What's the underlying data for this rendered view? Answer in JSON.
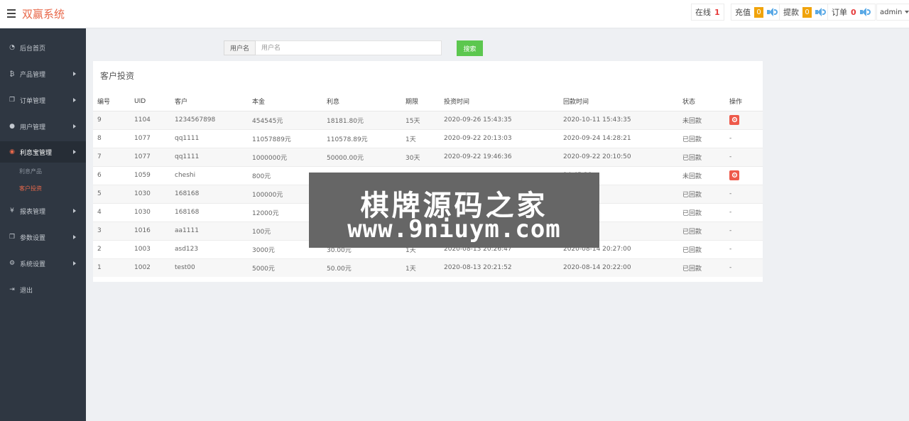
{
  "header": {
    "brand": "双赢系统",
    "online_label": "在线",
    "online_count": "1",
    "recharge_label": "充值",
    "recharge_count": "0",
    "withdraw_label": "提款",
    "withdraw_count": "0",
    "order_label": "订单",
    "order_count": "0",
    "user": "admin"
  },
  "sidebar": {
    "items": [
      {
        "label": "后台首页",
        "icon": "dashboard-icon"
      },
      {
        "label": "产品管理",
        "icon": "bitcoin-icon"
      },
      {
        "label": "订单管理",
        "icon": "copy-icon"
      },
      {
        "label": "用户管理",
        "icon": "user-icon"
      },
      {
        "label": "利息宝管理",
        "icon": "circle-icon"
      },
      {
        "label": "报表管理",
        "icon": "yen-icon"
      },
      {
        "label": "参数设置",
        "icon": "copy-icon"
      },
      {
        "label": "系统设置",
        "icon": "gears-icon"
      },
      {
        "label": "退出",
        "icon": "sign-out-icon"
      }
    ],
    "sub_items": [
      "利息产品",
      "客户投资"
    ]
  },
  "search": {
    "addon": "用户名",
    "placeholder": "用户名",
    "button": "搜索"
  },
  "panel": {
    "title": "客户投资",
    "columns": [
      "编号",
      "UID",
      "客户",
      "本金",
      "利息",
      "期限",
      "投资时间",
      "回款时间",
      "状态",
      "操作"
    ],
    "rows": [
      [
        "9",
        "1104",
        "1234567898",
        "454545元",
        "18181.80元",
        "15天",
        "2020-09-26 15:43:35",
        "2020-10-11 15:43:35",
        "未回款",
        ""
      ],
      [
        "8",
        "1077",
        "qq1111",
        "11057889元",
        "110578.89元",
        "1天",
        "2020-09-22 20:13:03",
        "2020-09-24 14:28:21",
        "已回款",
        "-"
      ],
      [
        "7",
        "1077",
        "qq1111",
        "1000000元",
        "50000.00元",
        "30天",
        "2020-09-22 19:46:36",
        "2020-09-22 20:10:50",
        "已回款",
        "-"
      ],
      [
        "6",
        "1059",
        "cheshi",
        "800元",
        "",
        "",
        "",
        "14:45:28",
        "未回款",
        ""
      ],
      [
        "5",
        "1030",
        "168168",
        "100000元",
        "",
        "",
        "",
        "12:09:00",
        "已回款",
        "-"
      ],
      [
        "4",
        "1030",
        "168168",
        "12000元",
        "",
        "",
        "",
        "23:13:00",
        "已回款",
        "-"
      ],
      [
        "3",
        "1016",
        "aa1111",
        "100元",
        "",
        "",
        "",
        "10:25:46",
        "已回款",
        "-"
      ],
      [
        "2",
        "1003",
        "asd123",
        "3000元",
        "30.00元",
        "1天",
        "2020-08-13 20:26:47",
        "2020-08-14 20:27:00",
        "已回款",
        "-"
      ],
      [
        "1",
        "1002",
        "test00",
        "5000元",
        "50.00元",
        "1天",
        "2020-08-13 20:21:52",
        "2020-08-14 20:22:00",
        "已回款",
        "-"
      ]
    ]
  },
  "watermark": {
    "line1": "棋牌源码之家",
    "line2": "www.9niuym.com"
  },
  "colors": {
    "brand": "#e8684a",
    "sidebar_bg": "#2f3742",
    "search_btn": "#5cc74f",
    "badge": "#f0a30a",
    "danger": "#ee5a4b"
  }
}
